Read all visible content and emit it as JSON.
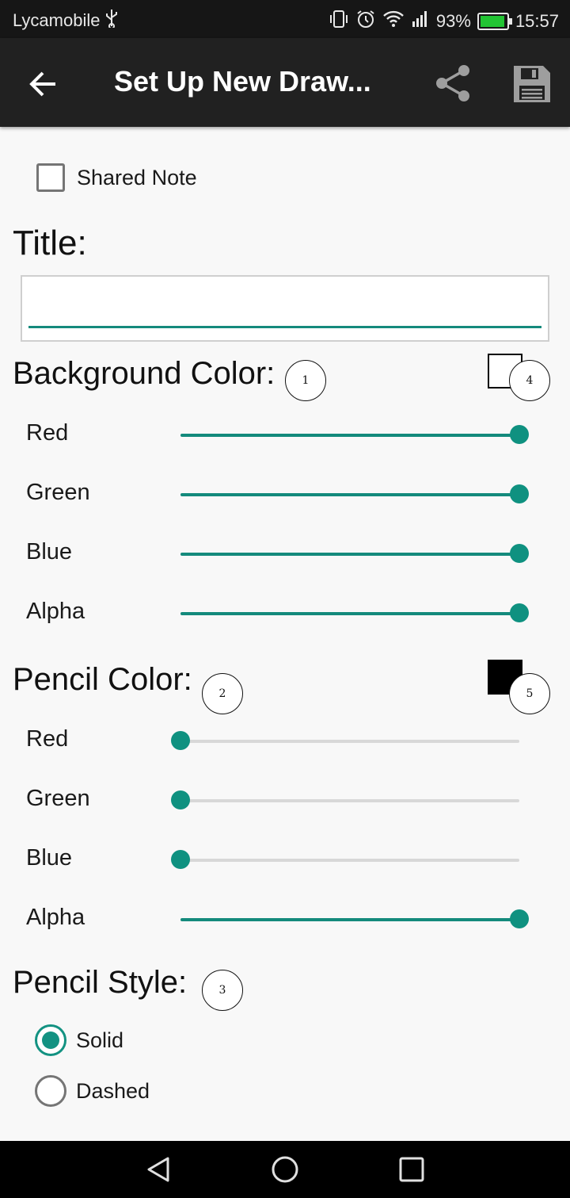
{
  "status_bar": {
    "carrier": "Lycamobile",
    "usb_icon": "usb-icon",
    "battery_percent": "93%",
    "time": "15:57",
    "battery_color": "#22c433"
  },
  "toolbar": {
    "title": "Set Up New Draw...",
    "back_icon": "arrow-back-icon",
    "share_icon": "share-icon",
    "save_icon": "save-floppy-icon"
  },
  "shared_note": {
    "label": "Shared Note",
    "checked": false
  },
  "title_section": {
    "label": "Title:",
    "value": "",
    "accent_color": "#148a7c"
  },
  "background_color": {
    "label": "Background Color:",
    "badge": "1",
    "preview_badge": "4",
    "preview_color": "#ffffff",
    "sliders": [
      {
        "label": "Red",
        "value": 1.0
      },
      {
        "label": "Green",
        "value": 1.0
      },
      {
        "label": "Blue",
        "value": 1.0
      },
      {
        "label": "Alpha",
        "value": 1.0
      }
    ]
  },
  "pencil_color": {
    "label": "Pencil Color:",
    "badge": "2",
    "preview_badge": "5",
    "preview_color": "#000000",
    "sliders": [
      {
        "label": "Red",
        "value": 0.0
      },
      {
        "label": "Green",
        "value": 0.0
      },
      {
        "label": "Blue",
        "value": 0.0
      },
      {
        "label": "Alpha",
        "value": 1.0
      }
    ]
  },
  "pencil_style": {
    "label": "Pencil Style:",
    "badge": "3",
    "options": [
      {
        "label": "Solid",
        "checked": true
      },
      {
        "label": "Dashed",
        "checked": false
      }
    ]
  },
  "nav_bar": {
    "back_icon": "nav-back-icon",
    "home_icon": "nav-home-icon",
    "recents_icon": "nav-recents-icon"
  }
}
